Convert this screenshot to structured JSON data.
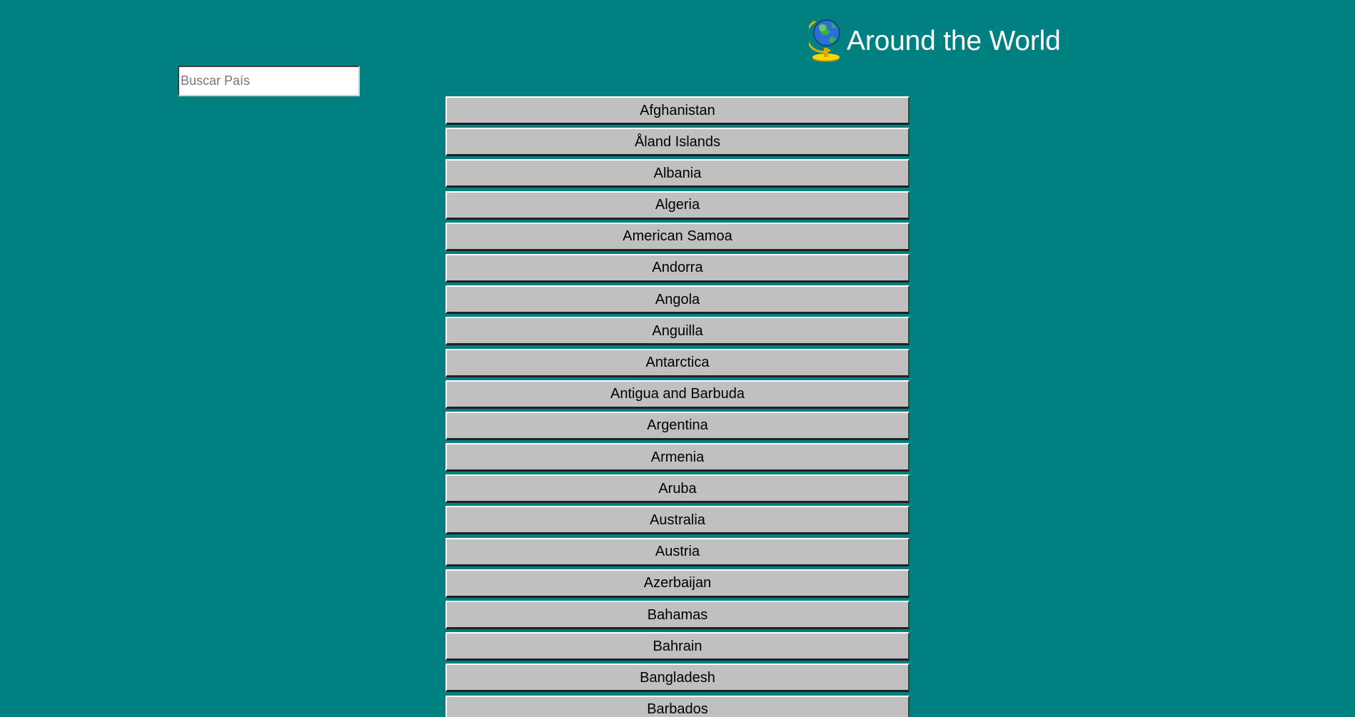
{
  "header": {
    "title": "Around the World",
    "icon": "globe-icon"
  },
  "search": {
    "placeholder": "Buscar País",
    "value": ""
  },
  "countries": [
    "Afghanistan",
    "Åland Islands",
    "Albania",
    "Algeria",
    "American Samoa",
    "Andorra",
    "Angola",
    "Anguilla",
    "Antarctica",
    "Antigua and Barbuda",
    "Argentina",
    "Armenia",
    "Aruba",
    "Australia",
    "Austria",
    "Azerbaijan",
    "Bahamas",
    "Bahrain",
    "Bangladesh",
    "Barbados"
  ],
  "colors": {
    "background": "#008080",
    "button_face": "#c0c0c0",
    "title_text": "#ffffff"
  }
}
